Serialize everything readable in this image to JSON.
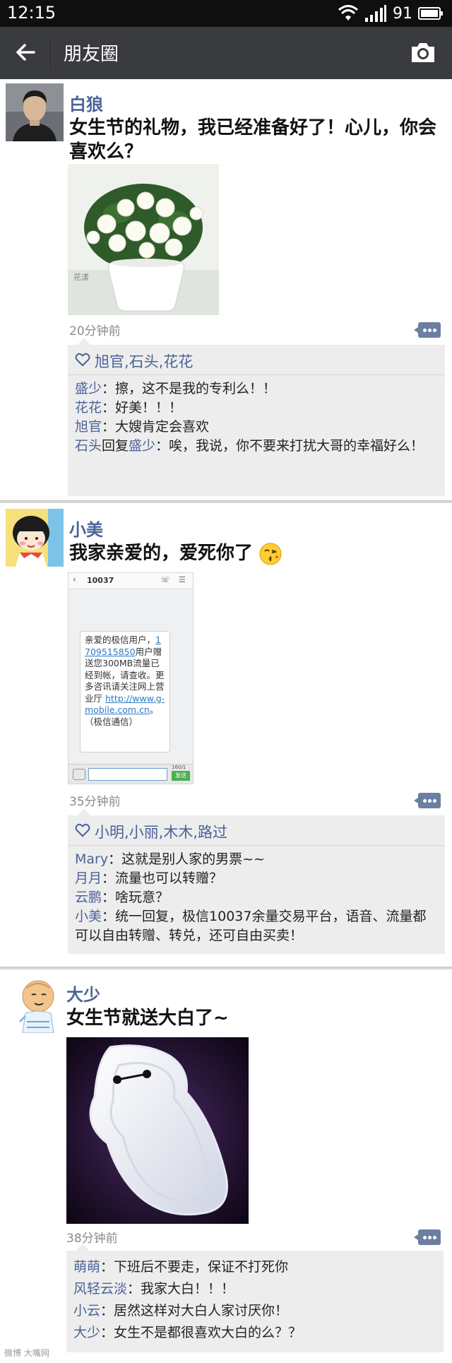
{
  "status_bar": {
    "time": "12:15",
    "battery": "91"
  },
  "topbar": {
    "title": "朋友圈"
  },
  "posts": [
    {
      "author": "白狼",
      "text": "女生节的礼物，我已经准备好了！心儿，你会喜欢么？",
      "photo_caption": "花漾",
      "time": "20分钟前",
      "likes": "旭官,石头,花花",
      "comments": [
        {
          "name": "盛少",
          "sep": "：",
          "text": "擦，这不是我的专利么！！"
        },
        {
          "name": "花花",
          "sep": "：",
          "text": "好美！！！"
        },
        {
          "name": "旭官",
          "sep": "：",
          "text": "大嫂肯定会喜欢"
        },
        {
          "name": "石头",
          "sep": "回复",
          "name2": "盛少",
          "text2": "：唉，我说，你不要来打扰大哥的幸福好么！"
        }
      ]
    },
    {
      "author": "小美",
      "text": "我家亲爱的，爱死你了",
      "sms": {
        "number": "10037",
        "message_pre": "亲爱的极信用户，",
        "message_phone": "1709515850",
        "message_mid": "用户赠送您300MB流量已经到帐，请查收。更多咨讯请关注网上营业厅",
        "message_link": "http://www.g-mobile.com.cn",
        "message_post": "。（极信通信）",
        "counter": "160/1",
        "send": "发送"
      },
      "time": "35分钟前",
      "likes": "小明,小丽,木木,路过",
      "comments": [
        {
          "name": "Mary",
          "sep": "：",
          "text": "这就是别人家的男票~~"
        },
        {
          "name": "月月",
          "sep": "：",
          "text": "流量也可以转赠？"
        },
        {
          "name": "云鹏",
          "sep": "：",
          "text": "啥玩意？"
        },
        {
          "name": "小美",
          "sep": "：",
          "text": "统一回复，极信10037余量交易平台，语音、流量都可以自由转赠、转兑，还可自由买卖！"
        }
      ]
    },
    {
      "author": "大少",
      "text": "女生节就送大白了~",
      "time": "38分钟前",
      "comments": [
        {
          "name": "萌萌",
          "sep": "：",
          "text": "下班后不要走，保证不打死你"
        },
        {
          "name": "风轻云淡",
          "sep": "：",
          "text": "我家大白！！！"
        },
        {
          "name": "小云",
          "sep": "：",
          "text": "居然这样对大白人家讨厌你！"
        },
        {
          "name": "大少",
          "sep": "：",
          "text": "女生不是都很喜欢大白的么？？"
        }
      ]
    }
  ],
  "watermark": "微博 大嘴网",
  "colors": {
    "link_blue": "#4b6397",
    "topbar": "#3a3b3e",
    "comment_bg": "#ededed"
  }
}
